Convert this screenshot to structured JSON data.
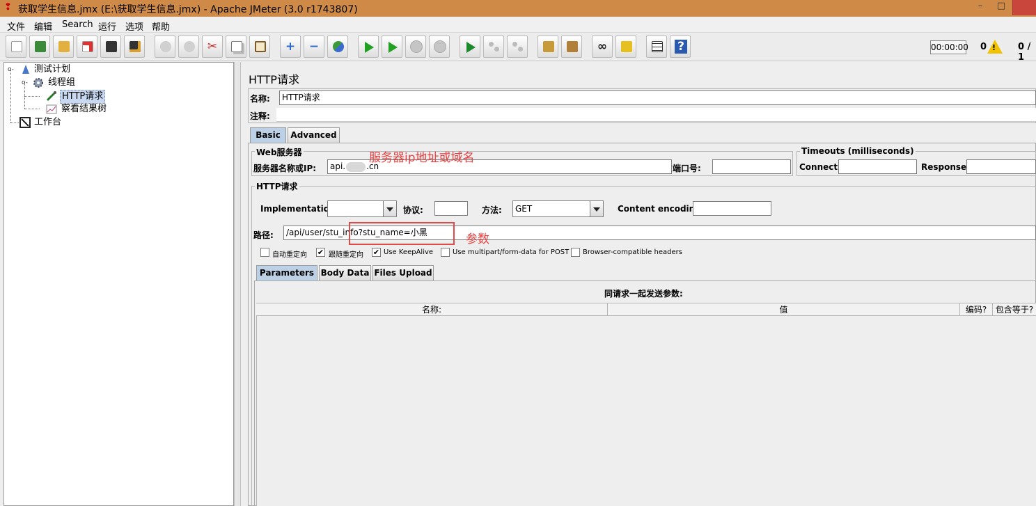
{
  "window": {
    "title": "获取学生信息.jmx (E:\\获取学生信息.jmx) - Apache JMeter (3.0 r1743807)",
    "minimize_glyph": "–",
    "maximize_glyph": "□"
  },
  "menu": [
    "文件",
    "编辑",
    "Search",
    "运行",
    "选项",
    "帮助"
  ],
  "toolbar": {
    "timer": "00:00:00",
    "warning_count": "0",
    "warning_glyph": "!",
    "threads": "0 / 1",
    "icons": [
      "new-icon",
      "templates-icon",
      "open-icon",
      "close-icon",
      "save-icon",
      "save-as-icon",
      "undo-icon",
      "redo-icon",
      "cut-icon",
      "copy-icon",
      "paste-icon",
      "expand-icon",
      "collapse-icon",
      "toggle-icon",
      "start-icon",
      "start-no-pauses-icon",
      "stop-icon",
      "shutdown-icon",
      "remote-start-icon",
      "remote-stop-icon",
      "remote-shutdown-icon",
      "clear-icon",
      "clear-all-icon",
      "search-icon",
      "reset-search-icon",
      "function-helper-icon",
      "help-icon"
    ],
    "glyphs": {
      "expand": "+",
      "collapse": "−",
      "help": "?"
    }
  },
  "tree": {
    "plan": "测试计划",
    "thread_group": "线程组",
    "http_request": "HTTP请求",
    "results_tree": "察看结果树",
    "workbench": "工作台"
  },
  "panel": {
    "title": "HTTP请求",
    "name_label": "名称:",
    "name_value": "HTTP请求",
    "comment_label": "注释:",
    "tabs": [
      "Basic",
      "Advanced"
    ],
    "web_server": {
      "group_title": "Web服务器",
      "server_label": "服务器名称或IP:",
      "server_value_prefix": "api.",
      "server_value_suffix": ".cn",
      "port_label": "端口号:"
    },
    "timeouts": {
      "group_title": "Timeouts (milliseconds)",
      "connect_label": "Connect:",
      "response_label": "Response:"
    },
    "http_request": {
      "group_title": "HTTP请求",
      "implementation_label": "Implementation:",
      "protocol_label": "协议:",
      "method_label": "方法:",
      "method_value": "GET",
      "encoding_label": "Content encoding:",
      "path_label": "路径:",
      "path_value": "/api/user/stu_info?stu_name=小黑",
      "checkboxes": [
        {
          "label": "自动重定向",
          "checked": false
        },
        {
          "label": "跟随重定向",
          "checked": true
        },
        {
          "label": "Use KeepAlive",
          "checked": true
        },
        {
          "label": "Use multipart/form-data for POST",
          "checked": false
        },
        {
          "label": "Browser-compatible headers",
          "checked": false
        }
      ],
      "check_glyph": "✔"
    },
    "sub_tabs": [
      "Parameters",
      "Body Data",
      "Files Upload"
    ],
    "params": {
      "caption": "同请求一起发送参数:",
      "columns": [
        "名称:",
        "值",
        "编码?",
        "包含等于?"
      ]
    }
  },
  "annotations": {
    "server_note": "服务器ip地址或域名",
    "param_note": "参数"
  },
  "colors": {
    "titlebar": "#cf8a48",
    "annotation": "#e84040",
    "selected_tab": "#bcd0e6"
  }
}
